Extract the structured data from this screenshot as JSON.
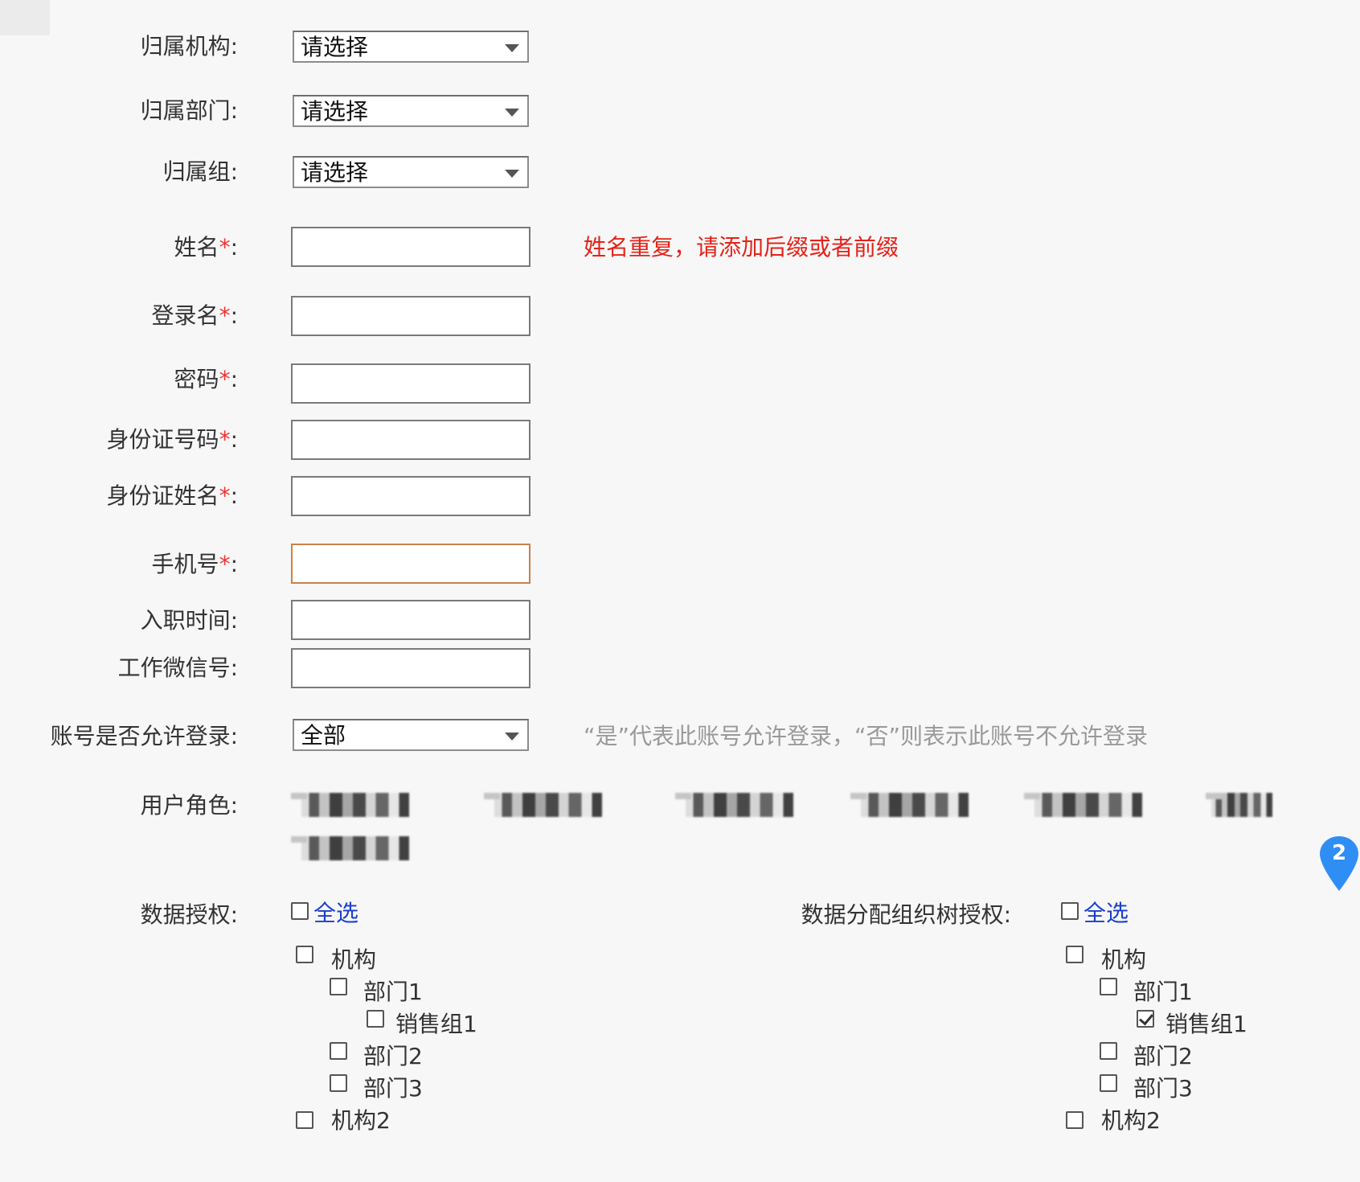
{
  "form": {
    "org": {
      "label": "归属机构:",
      "value": "请选择"
    },
    "dept": {
      "label": "归属部门:",
      "value": "请选择"
    },
    "group": {
      "label": "归属组:",
      "value": "请选择"
    },
    "name": {
      "label": "姓名",
      "value": "",
      "error": "姓名重复，请添加后缀或者前缀"
    },
    "login": {
      "label": "登录名",
      "value": ""
    },
    "password": {
      "label": "密码",
      "value": ""
    },
    "idnum": {
      "label": "身份证号码",
      "value": ""
    },
    "idname": {
      "label": "身份证姓名",
      "value": ""
    },
    "phone": {
      "label": "手机号",
      "value": ""
    },
    "joindate": {
      "label": "入职时间:",
      "value": ""
    },
    "wechat": {
      "label": "工作微信号:",
      "value": ""
    },
    "allow_login": {
      "label": "账号是否允许登录:",
      "value": "全部",
      "hint": "“是”代表此账号允许登录，“否”则表示此账号不允许登录"
    },
    "roles": {
      "label": "用户角色:"
    },
    "required_mark": "*",
    "colon": ":"
  },
  "data_auth": {
    "label": "数据授权:",
    "select_all": "全选",
    "tree": [
      {
        "label": "机构",
        "checked": false
      },
      {
        "label": "部门1",
        "checked": false
      },
      {
        "label": "销售组1",
        "checked": false
      },
      {
        "label": "部门2",
        "checked": false
      },
      {
        "label": "部门3",
        "checked": false
      },
      {
        "label": "机构2",
        "checked": false
      }
    ]
  },
  "tree_auth": {
    "label": "数据分配组织树授权:",
    "select_all": "全选",
    "tree": [
      {
        "label": "机构",
        "checked": false
      },
      {
        "label": "部门1",
        "checked": false
      },
      {
        "label": "销售组1",
        "checked": true
      },
      {
        "label": "部门2",
        "checked": false
      },
      {
        "label": "部门3",
        "checked": false
      },
      {
        "label": "机构2",
        "checked": false
      }
    ]
  },
  "badge": {
    "count": "2"
  },
  "colors": {
    "error": "#e2231a",
    "link": "#1a3ec9",
    "badge": "#2f8ef4",
    "focus_border": "#c9824b"
  }
}
